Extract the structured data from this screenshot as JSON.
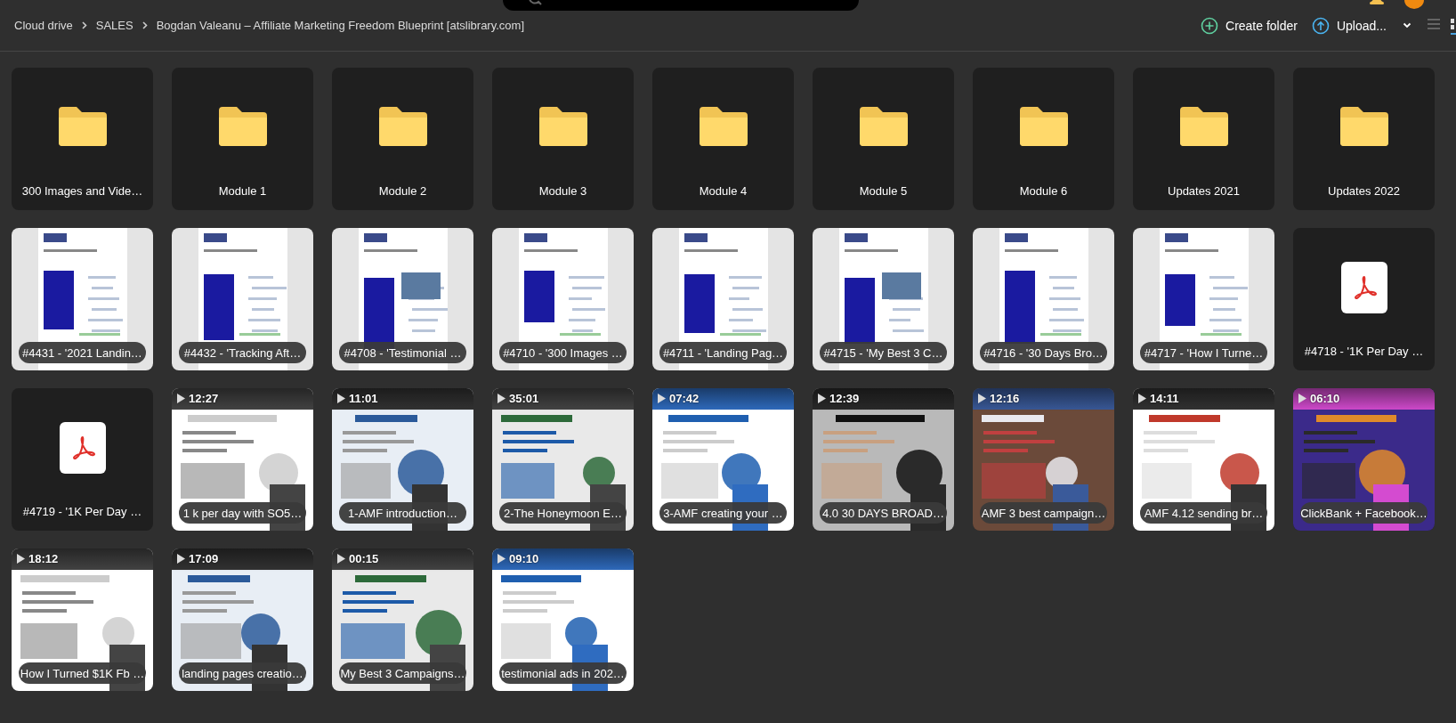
{
  "breadcrumb": [
    "Cloud drive",
    "SALES",
    "Bogdan Valeanu – Affiliate Marketing Freedom Blueprint [atslibrary.com]"
  ],
  "actions": [
    {
      "kind": "create",
      "label": "Create folder"
    },
    {
      "kind": "upload",
      "label": "Upload..."
    }
  ],
  "view_toggle": [
    {
      "kind": "list",
      "selected": false
    },
    {
      "kind": "grid",
      "selected": true
    }
  ],
  "tiles": [
    {
      "kind": "folder",
      "label": "300 Images and Vide…"
    },
    {
      "kind": "folder",
      "label": "Module 1"
    },
    {
      "kind": "folder",
      "label": "Module 2"
    },
    {
      "kind": "folder",
      "label": "Module 3"
    },
    {
      "kind": "folder",
      "label": "Module 4"
    },
    {
      "kind": "folder",
      "label": "Module 5"
    },
    {
      "kind": "folder",
      "label": "Module 6"
    },
    {
      "kind": "folder",
      "label": "Updates 2021"
    },
    {
      "kind": "folder",
      "label": "Updates 2022"
    },
    {
      "kind": "document",
      "label": "#4431 - '2021 Landin…"
    },
    {
      "kind": "document",
      "label": "#4432 - 'Tracking Aft…"
    },
    {
      "kind": "document",
      "label": "#4708 - 'Testimonial …"
    },
    {
      "kind": "document",
      "label": "#4710 - '300 Images …"
    },
    {
      "kind": "document",
      "label": "#4711 - 'Landing Pag…"
    },
    {
      "kind": "document",
      "label": "#4715 - 'My Best 3 C…"
    },
    {
      "kind": "document",
      "label": "#4716 - '30 Days Bro…"
    },
    {
      "kind": "document",
      "label": "#4717 - 'How I Turne…"
    },
    {
      "kind": "pdf",
      "label": "#4718 - '1K Per Day …"
    },
    {
      "kind": "pdf",
      "label": "#4719 - '1K Per Day …"
    },
    {
      "kind": "video",
      "duration": "12:27",
      "label": "1 k per day with SO5…"
    },
    {
      "kind": "video",
      "duration": "11:01",
      "label": "1-AMF introduction…"
    },
    {
      "kind": "video",
      "duration": "35:01",
      "label": "2-The Honeymoon E…"
    },
    {
      "kind": "video",
      "duration": "07:42",
      "label": "3-AMF creating your …"
    },
    {
      "kind": "video",
      "duration": "12:39",
      "label": "4.0 30 DAYS BROAD…"
    },
    {
      "kind": "video",
      "duration": "12:16",
      "label": "AMF 3 best campaign…"
    },
    {
      "kind": "video",
      "duration": "14:11",
      "label": "AMF 4.12 sending br…"
    },
    {
      "kind": "video",
      "duration": "06:10",
      "label": "ClickBank + Facebook…"
    },
    {
      "kind": "video",
      "duration": "18:12",
      "label": "How I Turned $1K Fb …"
    },
    {
      "kind": "video",
      "duration": "17:09",
      "label": "landing pages creatio…"
    },
    {
      "kind": "video",
      "duration": "00:15",
      "label": "My Best 3 Campaigns…"
    },
    {
      "kind": "video",
      "duration": "09:10",
      "label": "testimonial ads in 202…"
    }
  ]
}
